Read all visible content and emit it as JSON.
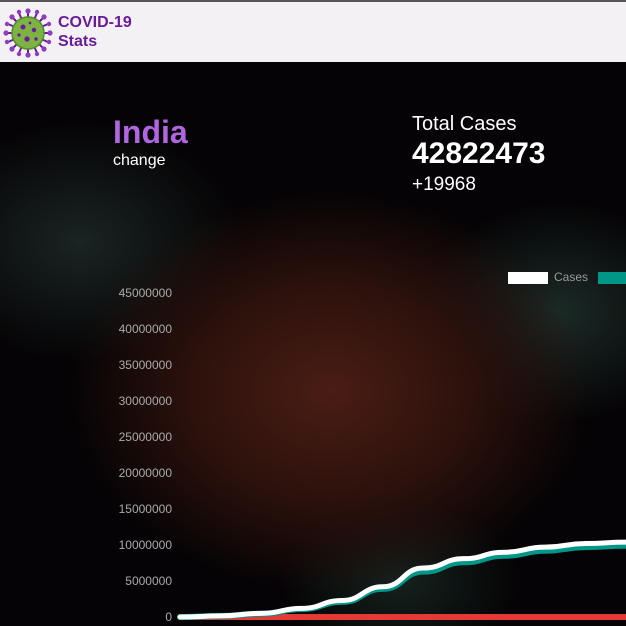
{
  "header": {
    "brand_line1": "COVID-19",
    "brand_line2": "Stats",
    "logo_icon": "virus-icon"
  },
  "hero": {
    "country": "India",
    "change_label": "change",
    "total_label": "Total Cases",
    "total_value": "42822473",
    "total_change": "+19968"
  },
  "colors": {
    "accent": "#b066e0",
    "brand": "#6a1b9a",
    "cases": "#ffffff",
    "series2": "#009688",
    "series3": "#e53935"
  },
  "chart_data": {
    "type": "line",
    "ylim": [
      0,
      45000000
    ],
    "y_ticks": [
      "0",
      "5000000",
      "10000000",
      "15000000",
      "20000000",
      "25000000",
      "30000000",
      "35000000",
      "40000000",
      "45000000"
    ],
    "legend": {
      "placement": "top-right",
      "entries": [
        "Cases"
      ]
    },
    "series": [
      {
        "name": "Cases",
        "color": "#ffffff",
        "values": [
          0,
          150000,
          500000,
          1200000,
          2300000,
          4200000,
          6800000,
          8100000,
          9000000,
          9700000,
          10200000,
          10400000
        ]
      },
      {
        "color": "#009688",
        "values": [
          0,
          140000,
          450000,
          1100000,
          2100000,
          3900000,
          6300000,
          7600000,
          8500000,
          9200000,
          9700000,
          9900000
        ]
      },
      {
        "color": "#e53935",
        "values": [
          0,
          0,
          0,
          0,
          0,
          0,
          0,
          0,
          0,
          0,
          0,
          0
        ]
      }
    ]
  }
}
